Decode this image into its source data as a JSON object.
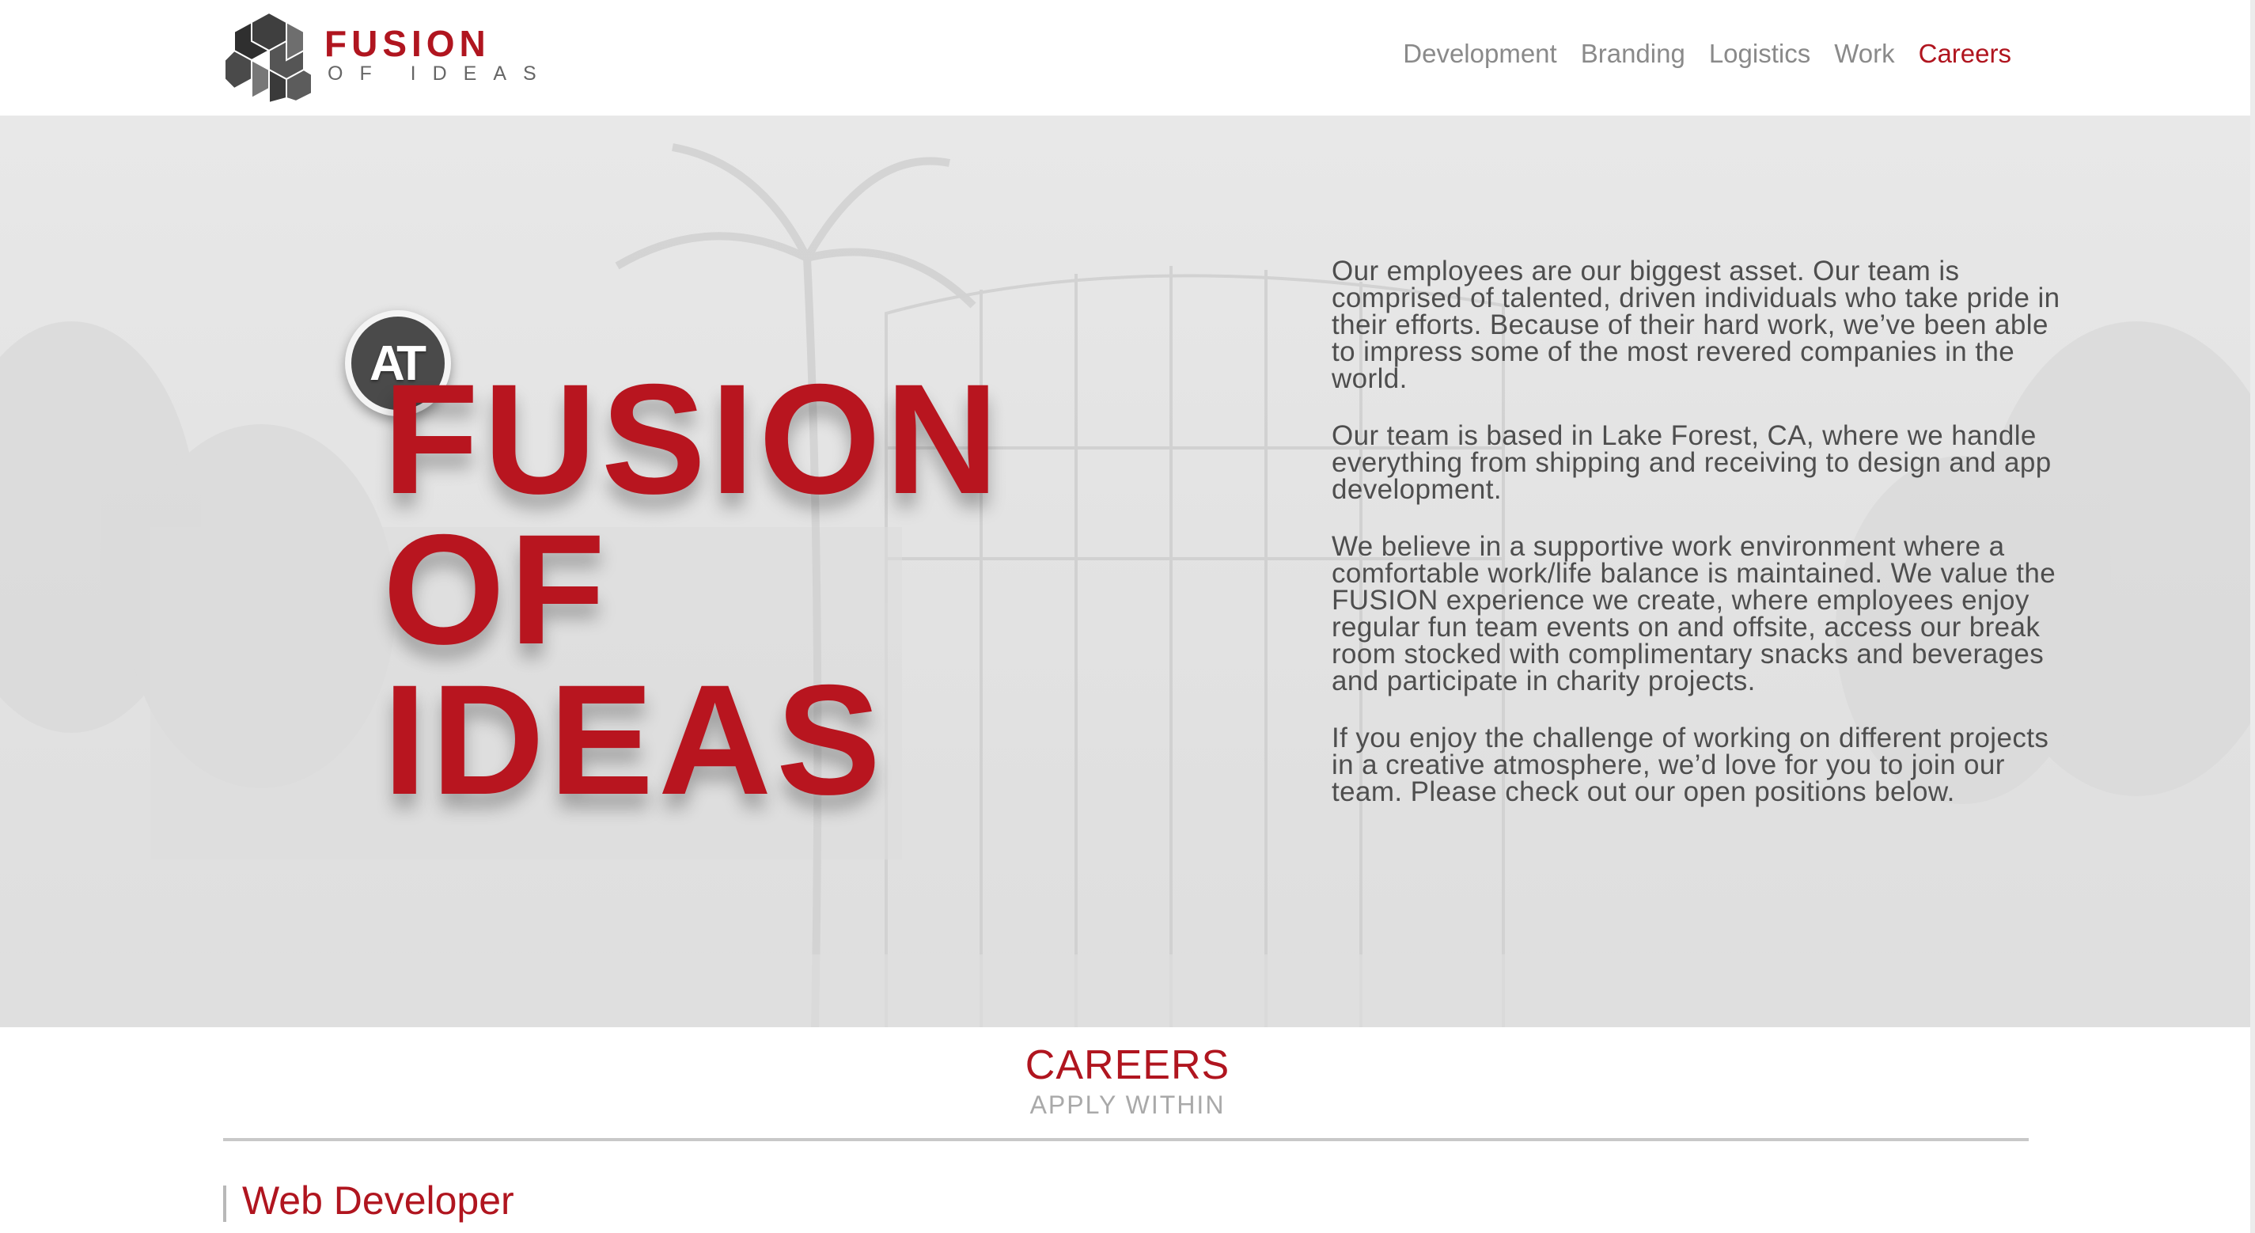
{
  "logo": {
    "word1": "FUSION",
    "word2": "OF IDEAS",
    "icon": "hexagon-cubes-icon"
  },
  "nav": {
    "items": [
      "Development",
      "Branding",
      "Logistics",
      "Work",
      "Careers"
    ],
    "active": "Careers"
  },
  "hero": {
    "badge": "AT",
    "title_lines": [
      "FUSION",
      "OF",
      "IDEAS"
    ],
    "paragraphs": [
      "Our employees are our biggest asset. Our team is comprised of talented, driven individuals who take pride in their efforts. Because of their hard work, we’ve been able to impress some of the most revered companies in the world.",
      "Our team is based in Lake Forest, CA, where we handle everything from shipping and receiving to design and app development.",
      "We believe in a supportive work environment where a comfortable work/life balance is maintained. We value the FUSION experience we create, where employees enjoy regular fun team events on and offsite, access our break room stocked with complimentary snacks and beverages and participate in charity projects.",
      "If you enjoy the challenge of working on different projects in a creative atmosphere, we’d love for you to join our team. Please check out our open positions below."
    ]
  },
  "careers": {
    "title": "CAREERS",
    "subtitle": "APPLY WITHIN",
    "jobs": [
      "Web Developer"
    ]
  },
  "colors": {
    "brand_red": "#b0151f",
    "nav_gray": "#8a8a8a",
    "text_gray": "#4e4e4e"
  }
}
